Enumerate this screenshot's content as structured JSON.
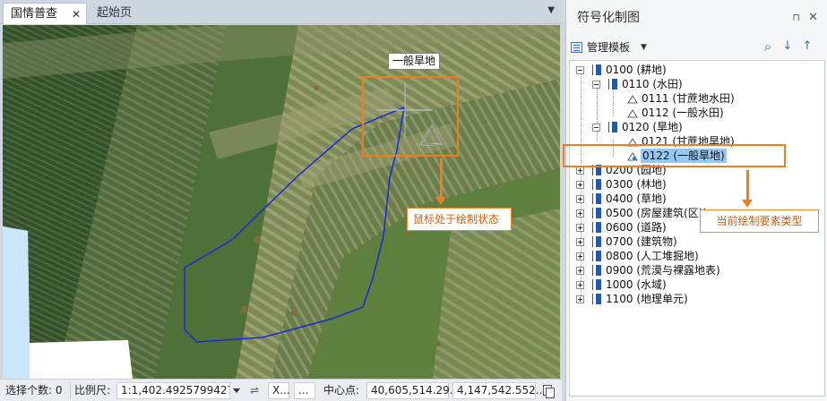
{
  "tabs": {
    "active_label": "国情普查",
    "close_glyph": "✕",
    "inactive_label": "起始页",
    "menu_glyph": "▼"
  },
  "map": {
    "cursor_tooltip": "一般旱地",
    "callout_drawing": "鼠标处于绘制状态",
    "callout_type": "当前绘制要素类型",
    "highlight_color": "#ee7d22",
    "polygon_color": "#1a2bd6"
  },
  "statusbar": {
    "selected_count_label": "选择个数: 0",
    "scale_label": "比例尺:",
    "scale_value": "1:1,402.49257994272",
    "swap_glyph": "⇌",
    "x_field": "X...",
    "more_field": "...",
    "center_label": "中心点:",
    "center_x": "40,605,514.29...",
    "center_y": "4,147,542.552..."
  },
  "panel": {
    "title": "符号化制图",
    "pin_glyph": "⊓",
    "close_glyph": "✕",
    "template_button": "管理模板",
    "template_drop": "▼",
    "search_glyph": "⌕",
    "down_glyph": "↓",
    "up_glyph": "↑"
  },
  "tree": [
    {
      "label": "0100 (耕地)"
    },
    {
      "label": "0110 (水田)"
    },
    {
      "label": "0111 (甘蔗地水田)"
    },
    {
      "label": "0112 (一般水田)"
    },
    {
      "label": "0120 (旱地)"
    },
    {
      "label": "0121 (甘蔗地旱地)"
    },
    {
      "label": "0122 (一般旱地)"
    },
    {
      "label": "0200 (园地)"
    },
    {
      "label": "0300 (林地)"
    },
    {
      "label": "0400 (草地)"
    },
    {
      "label": "0500 (房屋建筑(区))"
    },
    {
      "label": "0600 (道路)"
    },
    {
      "label": "0700 (建筑物)"
    },
    {
      "label": "0800 (人工堆掘地)"
    },
    {
      "label": "0900 (荒漠与裸露地表)"
    },
    {
      "label": "1000 (水域)"
    },
    {
      "label": "1100 (地理单元)"
    }
  ]
}
